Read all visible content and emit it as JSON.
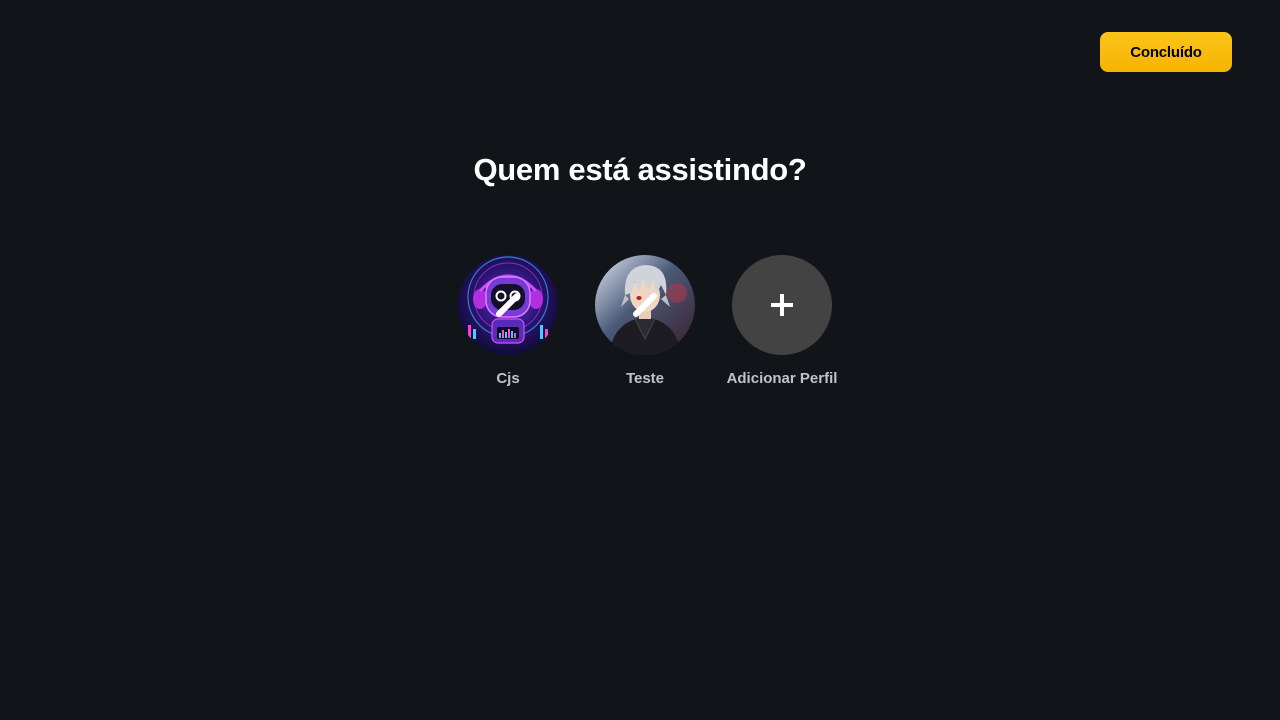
{
  "header": {
    "done_label": "Concluído"
  },
  "main": {
    "title": "Quem está assistindo?",
    "profiles": [
      {
        "name": "Cjs",
        "avatar_icon": "robot-avatar-image",
        "edit_icon": "pencil-icon"
      },
      {
        "name": "Teste",
        "avatar_icon": "anime-character-avatar-image",
        "edit_icon": "pencil-icon"
      }
    ],
    "add_profile": {
      "label": "Adicionar Perfil",
      "icon": "plus-icon"
    }
  },
  "colors": {
    "background": "#111418",
    "accent": "#fcc419",
    "add_circle": "#434343",
    "label_text": "#bfc3c9"
  }
}
